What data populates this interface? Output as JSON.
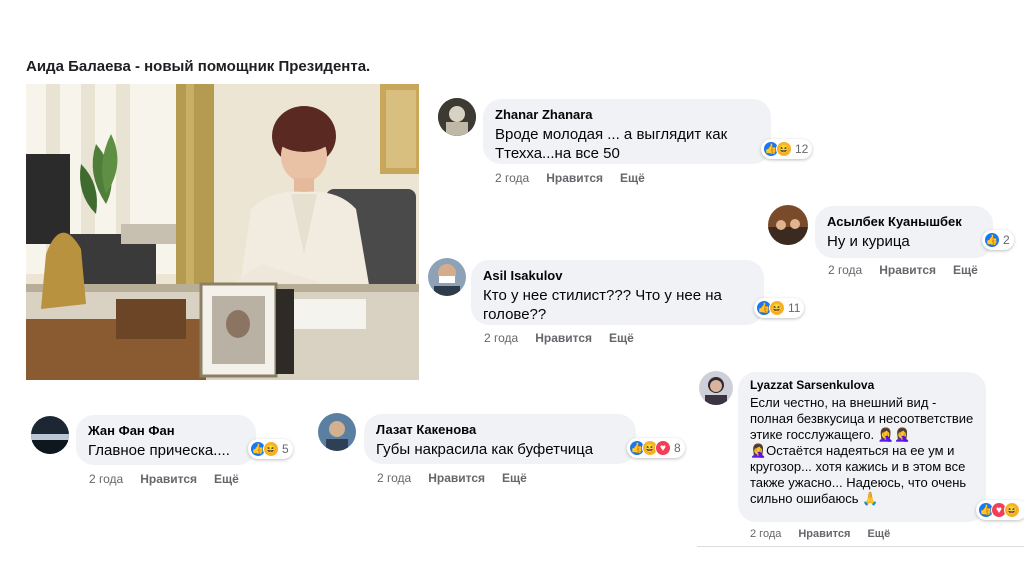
{
  "headline": "Аида Балаева - новый помощник Президента.",
  "comments": [
    {
      "author": "Zhanar Zhanara",
      "text": "Вроде молодая ... а выглядит как Ттехха...на все 50",
      "count": "12",
      "time": "2 года",
      "like": "Нравится",
      "reply": "Ещё"
    },
    {
      "author": "Асылбек Куанышбек",
      "text": "Ну и курица",
      "count": "2",
      "time": "2 года",
      "like": "Нравится",
      "reply": "Ещё"
    },
    {
      "author": "Asil Isakulov",
      "text": "Кто у нее стилист??? Что у нее на голове??",
      "count": "11",
      "time": "2 года",
      "like": "Нравится",
      "reply": "Ещё"
    },
    {
      "author": "Lyazzat Sarsenkulova",
      "text": "Если честно, на внешний вид - полная безвкусица и несоответствие этике госслужащего. 🤦‍♀️🤦‍♀️🤦‍♀️Остаётся надеяться на ее ум и кругозор... хотя кажись и в этом все также ужасно... Надеюсь, что очень сильно ошибаюсь 🙏",
      "count": "",
      "time": "2 года",
      "like": "Нравится",
      "reply": "Ещё"
    },
    {
      "author": "Жан Фан Фан",
      "text": "Главное прическа....",
      "count": "5",
      "time": "2 года",
      "like": "Нравится",
      "reply": "Ещё"
    },
    {
      "author": "Лазат Какенова",
      "text": "Губы накрасила как буфетчица",
      "count": "8",
      "time": "2 года",
      "like": "Нравится",
      "reply": "Ещё"
    }
  ],
  "icons": {
    "like": "thumbs-up",
    "haha": "laughing-face",
    "love": "heart"
  },
  "colors": {
    "bubble": "#f0f2f5",
    "meta": "#65676b",
    "like": "#1877f2",
    "haha": "#f7b125",
    "love": "#f33e58"
  }
}
